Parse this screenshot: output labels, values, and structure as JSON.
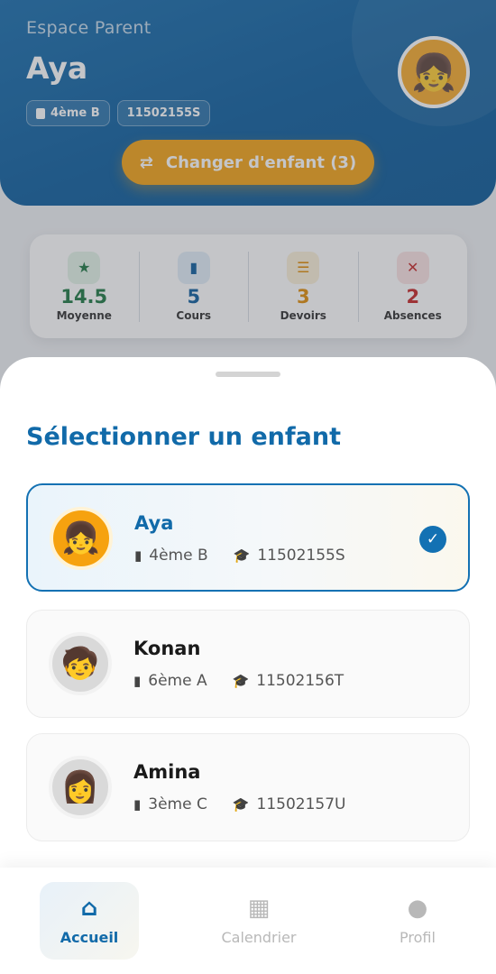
{
  "header": {
    "eyebrow": "Espace Parent",
    "child_name": "Aya",
    "class_chip": "4ème B",
    "id_chip": "11502155S",
    "switch_label": "Changer d'enfant (3)",
    "avatar_emoji": "👧"
  },
  "stats": [
    {
      "icon": "★",
      "value": "14.5",
      "label": "Moyenne",
      "color": "#1f7a45",
      "bg": "#e3f3e8"
    },
    {
      "icon": "▮",
      "value": "5",
      "label": "Cours",
      "color": "#0f5f9e",
      "bg": "#e2eef8"
    },
    {
      "icon": "☰",
      "value": "3",
      "label": "Devoirs",
      "color": "#e08e0b",
      "bg": "#fbf0d9"
    },
    {
      "icon": "✕",
      "value": "2",
      "label": "Absences",
      "color": "#c62828",
      "bg": "#fbe4e4"
    }
  ],
  "sheet": {
    "title": "Sélectionner un enfant",
    "children": [
      {
        "name": "Aya",
        "class": "4ème B",
        "id": "11502155S",
        "emoji": "👧",
        "selected": true
      },
      {
        "name": "Konan",
        "class": "6ème A",
        "id": "11502156T",
        "emoji": "🧒",
        "selected": false
      },
      {
        "name": "Amina",
        "class": "3ème C",
        "id": "11502157U",
        "emoji": "👩",
        "selected": false
      }
    ]
  },
  "nav": {
    "home": "Accueil",
    "calendar": "Calendrier",
    "profile": "Profil",
    "home_icon": "home-icon",
    "calendar_icon": "calendar-icon",
    "profile_icon": "person-icon"
  },
  "colors": {
    "primary": "#116aa9",
    "accent": "#f3a418"
  }
}
